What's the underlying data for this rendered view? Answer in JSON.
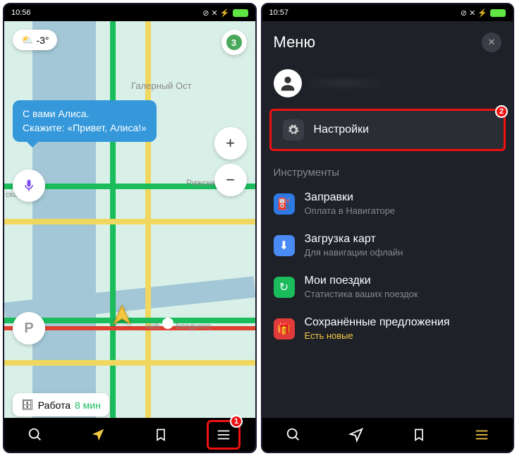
{
  "left": {
    "status_time": "10:56",
    "weather_temp": "-3°",
    "traffic_level": "3",
    "bubble_line1": "С вами Алиса.",
    "bubble_line2": "Скажите: «Привет, Алиса!»",
    "label_area1": "Галерный Ост",
    "label_area2": "Рижский",
    "label_area3": "бводного",
    "label_area4": "ская ул",
    "label_route_name": "наб",
    "parking_letter": "P",
    "work_chip_label": "Работа",
    "work_chip_time": "8 мин",
    "marker_1": "1"
  },
  "right": {
    "status_time": "10:57",
    "menu_title": "Меню",
    "marker_2": "2",
    "settings_label": "Настройки",
    "section_tools": "Инструменты",
    "items": [
      {
        "title": "Заправки",
        "sub": "Оплата в Навигаторе"
      },
      {
        "title": "Загрузка карт",
        "sub": "Для навигации офлайн"
      },
      {
        "title": "Мои поездки",
        "sub": "Статистика ваших поездок"
      },
      {
        "title": "Сохранённые предложения",
        "sub": "Есть новые"
      }
    ]
  }
}
